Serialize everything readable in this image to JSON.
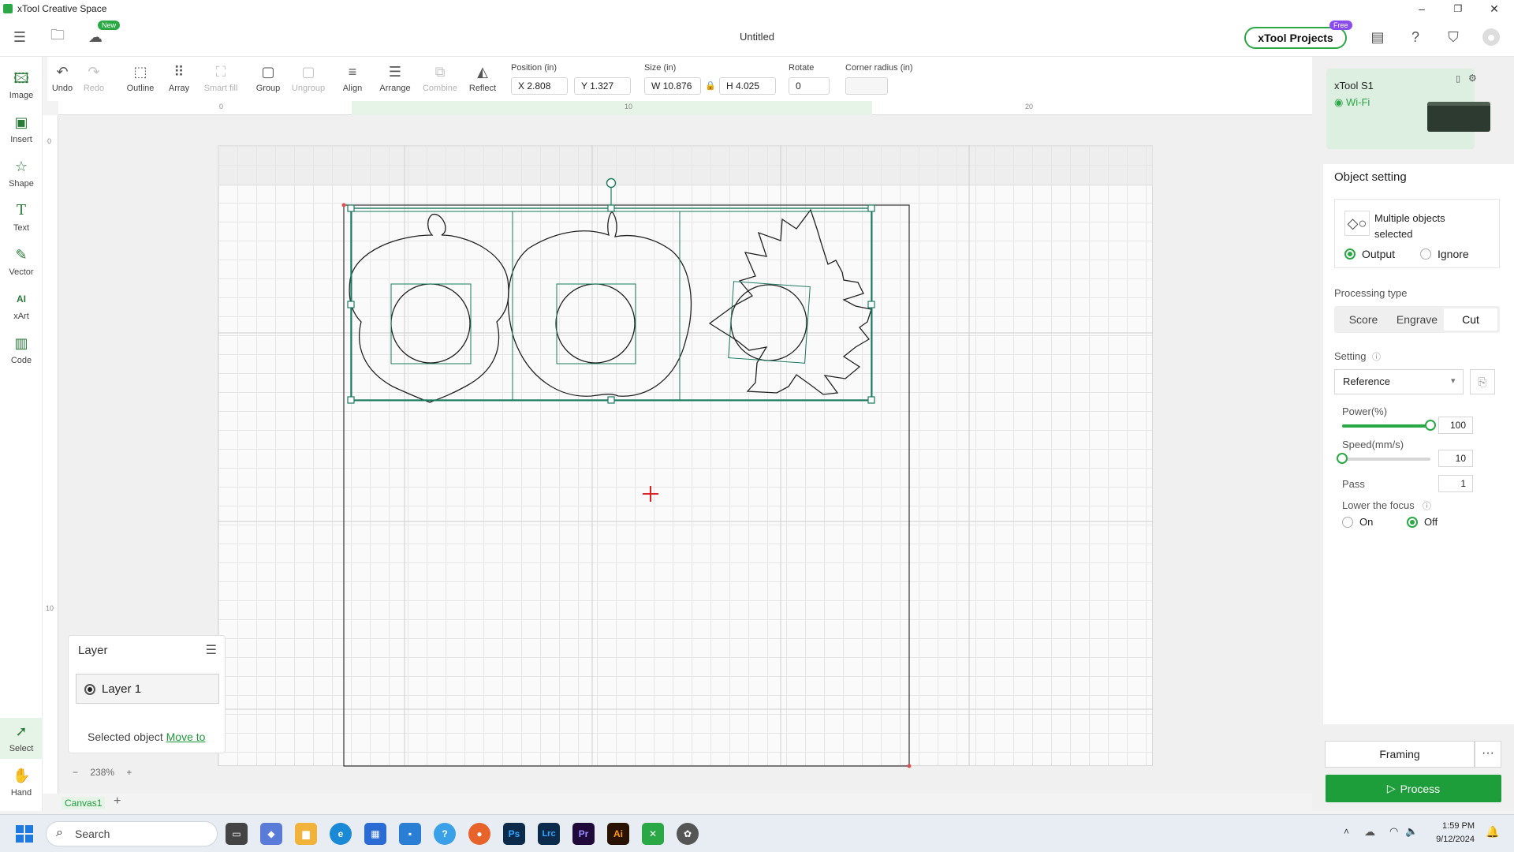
{
  "app": {
    "title": "xTool Creative Space",
    "document_title": "Untitled",
    "new_badge": "New",
    "projects_button": "xTool Projects",
    "free_badge": "Free"
  },
  "window_controls": {
    "minimize": "–",
    "maximize": "❐",
    "close": "✕"
  },
  "left_tools": [
    {
      "label": "Image",
      "icon": "image-icon"
    },
    {
      "label": "Insert",
      "icon": "insert-icon"
    },
    {
      "label": "Shape",
      "icon": "shape-icon"
    },
    {
      "label": "Text",
      "icon": "text-icon"
    },
    {
      "label": "Vector",
      "icon": "vector-icon"
    },
    {
      "label": "xArt",
      "icon": "xart-icon"
    },
    {
      "label": "Code",
      "icon": "code-icon"
    },
    {
      "label": "Select",
      "icon": "select-icon"
    },
    {
      "label": "Hand",
      "icon": "hand-icon"
    }
  ],
  "toolbar": {
    "undo": "Undo",
    "redo": "Redo",
    "outline": "Outline",
    "array": "Array",
    "smart_fill": "Smart fill",
    "group": "Group",
    "ungroup": "Ungroup",
    "align": "Align",
    "arrange": "Arrange",
    "combine": "Combine",
    "reflect": "Reflect",
    "position_label": "Position (in)",
    "position_x": "X 2.808",
    "position_y": "Y 1.327",
    "size_label": "Size (in)",
    "size_w": "W 10.876",
    "size_h": "H 4.025",
    "rotate_label": "Rotate",
    "rotate_value": "0",
    "corner_label": "Corner radius (in)",
    "corner_value": ""
  },
  "ruler": {
    "top_ticks": [
      "0",
      "10",
      "20"
    ],
    "left_ticks": [
      "0",
      "10"
    ]
  },
  "layer_panel": {
    "title": "Layer",
    "layer_name": "Layer 1",
    "selected_text": "Selected object",
    "move_to": "Move to"
  },
  "zoom": {
    "minus": "−",
    "value": "238%",
    "plus": "+"
  },
  "canvas_tabs": {
    "active": "Canvas1",
    "add": "+"
  },
  "device": {
    "name": "xTool S1",
    "connection": "Wi-Fi"
  },
  "object_setting": {
    "title": "Object setting",
    "description": "Multiple objects selected",
    "output_label": "Output",
    "ignore_label": "Ignore",
    "output_selected": true,
    "processing_type_label": "Processing type",
    "processing_types": [
      "Score",
      "Engrave",
      "Cut"
    ],
    "processing_active": "Cut",
    "setting_label": "Setting",
    "setting_value": "Reference",
    "power_label": "Power(%)",
    "power_value": "100",
    "power_fraction": 1.0,
    "speed_label": "Speed(mm/s)",
    "speed_value": "10",
    "speed_fraction": 0.0,
    "pass_label": "Pass",
    "pass_value": "1",
    "focus_label": "Lower the focus",
    "focus_on": "On",
    "focus_off": "Off",
    "focus_selected": "Off"
  },
  "actions": {
    "framing": "Framing",
    "more": "···",
    "process": "Process"
  },
  "taskbar": {
    "search_placeholder": "Search",
    "apps": [
      "Ps",
      "Lrc",
      "Pr",
      "Ai"
    ],
    "time": "1:59 PM",
    "date": "9/12/2024"
  },
  "colors": {
    "accent": "#2aa845",
    "process": "#1e9e3a",
    "selection": "#1a7a5e"
  }
}
